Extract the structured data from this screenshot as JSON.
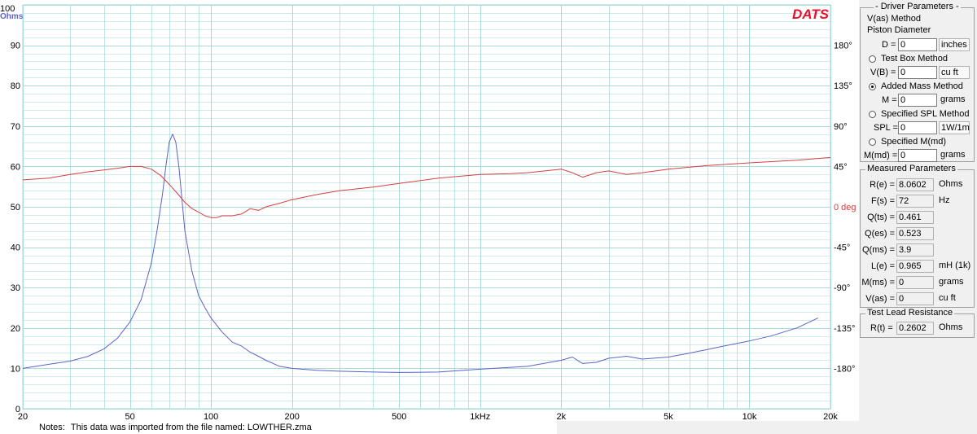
{
  "brand": "DATS",
  "notes": {
    "label": "Notes:",
    "text": "This data was imported from the file named:  LOWTHER.zma"
  },
  "colors": {
    "impedance": "#5b63c8",
    "phase": "#d64040",
    "grid": "#a8dada",
    "brand": "#e8102a"
  },
  "chart_data": {
    "type": "line",
    "x_scale": "log",
    "xlim": [
      20,
      20000
    ],
    "y_left": {
      "label": "Ohms",
      "ylim": [
        0,
        100
      ],
      "ticks": [
        "0",
        "10",
        "20",
        "30",
        "40",
        "50",
        "60",
        "70",
        "80",
        "90",
        "100"
      ]
    },
    "y_right": {
      "label": "deg",
      "ylim": [
        -225,
        225
      ],
      "ticks": [
        "-180°",
        "-135°",
        "-90°",
        "-45°",
        "0 deg",
        "45°",
        "90°",
        "135°",
        "180°"
      ]
    },
    "x_ticks": [
      "20",
      "50",
      "100",
      "200",
      "500",
      "1kHz",
      "2k",
      "5k",
      "10k",
      "20k"
    ],
    "grid": true,
    "series": [
      {
        "name": "impedance",
        "axis": "left",
        "x": [
          20,
          25,
          30,
          35,
          40,
          45,
          50,
          55,
          60,
          63,
          66,
          68,
          70,
          72,
          74,
          76,
          78,
          80,
          85,
          90,
          95,
          100,
          110,
          120,
          130,
          140,
          150,
          160,
          180,
          200,
          250,
          300,
          400,
          500,
          700,
          1000,
          1500,
          2000,
          2200,
          2400,
          2700,
          3000,
          3500,
          4000,
          5000,
          6000,
          7000,
          8000,
          10000,
          12000,
          15000,
          18000
        ],
        "y": [
          10,
          11,
          11.8,
          13,
          14.8,
          17.5,
          21.5,
          27,
          36,
          44,
          53,
          60,
          66,
          68,
          66,
          60,
          52,
          44,
          34,
          28,
          25,
          22.5,
          19,
          16.5,
          15.5,
          14,
          13,
          12,
          10.5,
          10,
          9.5,
          9.3,
          9.1,
          9,
          9.1,
          9.8,
          10.5,
          12,
          12.8,
          11.2,
          11.5,
          12.5,
          13,
          12.3,
          12.8,
          13.8,
          14.7,
          15.5,
          16.8,
          18,
          20,
          22.5
        ]
      },
      {
        "name": "phase",
        "axis": "right",
        "x": [
          20,
          25,
          30,
          35,
          40,
          45,
          50,
          55,
          60,
          65,
          70,
          75,
          80,
          85,
          90,
          95,
          100,
          105,
          110,
          120,
          130,
          140,
          150,
          160,
          180,
          200,
          250,
          300,
          400,
          500,
          700,
          1000,
          1300,
          1500,
          2000,
          2200,
          2400,
          2700,
          3000,
          3500,
          4000,
          5000,
          7000,
          10000,
          15000,
          20000
        ],
        "y": [
          30,
          32,
          36,
          39,
          41,
          43,
          45,
          45,
          42,
          35,
          25,
          15,
          5,
          -2,
          -6,
          -10,
          -12,
          -12,
          -10,
          -10,
          -8,
          -2,
          -4,
          0,
          4,
          8,
          14,
          18,
          22,
          26,
          32,
          36,
          37,
          38,
          42,
          38,
          33,
          38,
          40,
          36,
          38,
          42,
          46,
          49,
          52,
          55
        ]
      }
    ]
  },
  "driver_parameters": {
    "title": "- Driver Parameters -",
    "vas_method": "V(as) Method",
    "piston_diameter": "Piston Diameter",
    "d": {
      "label": "D =",
      "value": "0",
      "unit": "inches"
    },
    "test_box": {
      "label": "Test Box Method",
      "selected": false
    },
    "vb": {
      "label": "V(B) =",
      "value": "0",
      "unit": "cu ft"
    },
    "added_mass": {
      "label": "Added Mass Method",
      "selected": true
    },
    "m": {
      "label": "M =",
      "value": "0",
      "unit": "grams"
    },
    "spl_method": {
      "label": "Specified SPL Method",
      "selected": false
    },
    "spl": {
      "label": "SPL =",
      "value": "0",
      "unit": "1W/1m"
    },
    "mmd_method": {
      "label": "Specified M(md)",
      "selected": false
    },
    "mmd": {
      "label": "M(md) =",
      "value": "0",
      "unit": "grams"
    }
  },
  "measured_parameters": {
    "title": "Measured Parameters",
    "rows": [
      {
        "label": "R(e) =",
        "value": "8.0602",
        "unit": "Ohms"
      },
      {
        "label": "F(s) =",
        "value": "72",
        "unit": "Hz"
      },
      {
        "label": "Q(ts) =",
        "value": "0.461",
        "unit": ""
      },
      {
        "label": "Q(es) =",
        "value": "0.523",
        "unit": ""
      },
      {
        "label": "Q(ms) =",
        "value": "3.9",
        "unit": ""
      },
      {
        "label": "L(e) =",
        "value": "0.965",
        "unit": "mH (1k)"
      },
      {
        "label": "M(ms) =",
        "value": "0",
        "unit": "grams"
      },
      {
        "label": "V(as) =",
        "value": "0",
        "unit": "cu ft"
      }
    ]
  },
  "test_lead": {
    "title": "Test Lead Resistance",
    "label": "R(t) =",
    "value": "0.2602",
    "unit": "Ohms"
  }
}
